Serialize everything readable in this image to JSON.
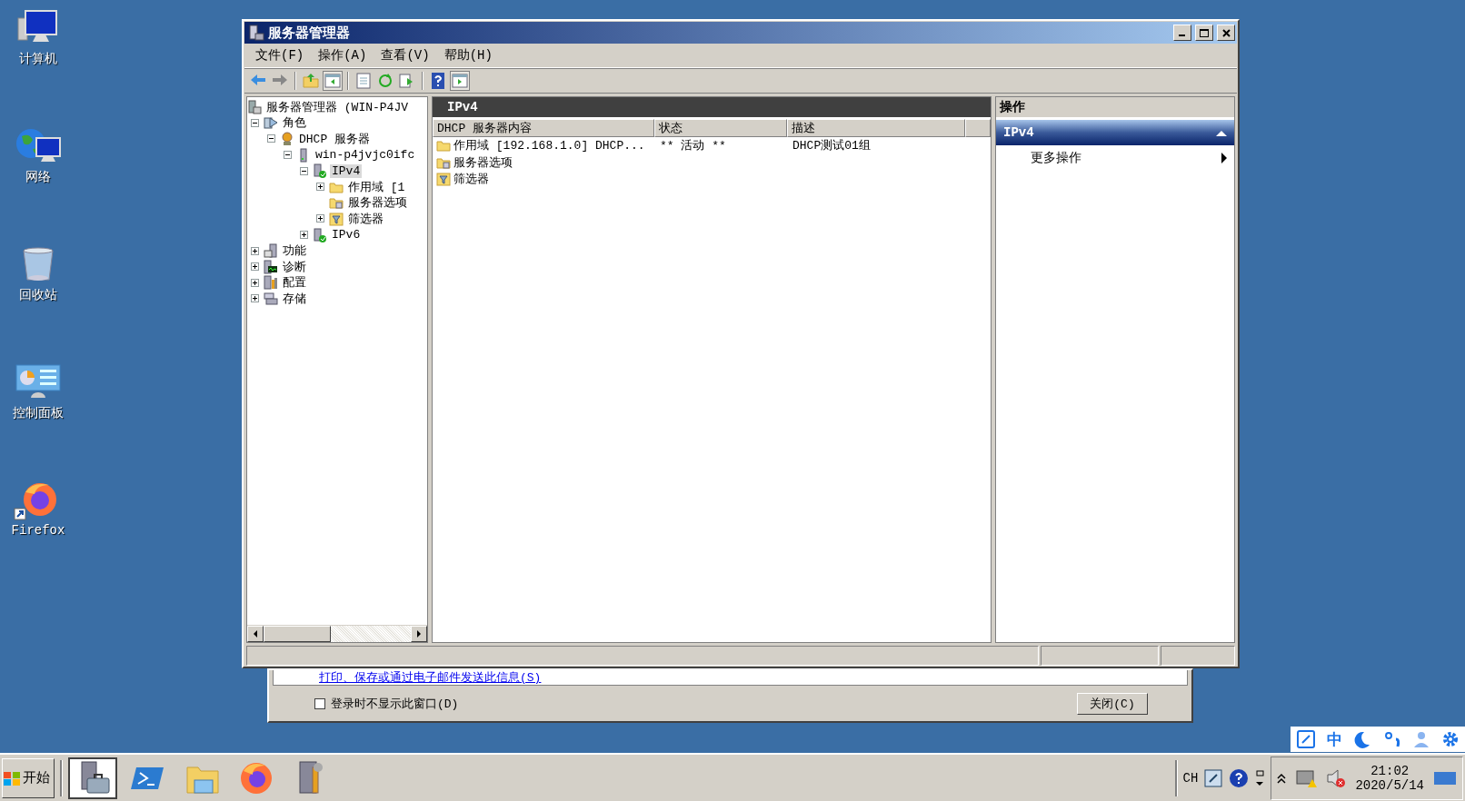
{
  "desktop_icons": [
    {
      "label": "计算机",
      "kind": "computer"
    },
    {
      "label": "网络",
      "kind": "network"
    },
    {
      "label": "回收站",
      "kind": "recycle"
    },
    {
      "label": "控制面板",
      "kind": "control"
    },
    {
      "label": "Firefox",
      "kind": "firefox"
    }
  ],
  "window": {
    "title": "服务器管理器",
    "menu": [
      "文件(F)",
      "操作(A)",
      "查看(V)",
      "帮助(H)"
    ],
    "tree": {
      "label": "服务器管理器 (WIN-P4JV",
      "kind": "manager",
      "selected": false,
      "children": [
        {
          "label": "角色",
          "kind": "roles",
          "expanded": true,
          "selected": false,
          "children": [
            {
              "label": "DHCP 服务器",
              "kind": "dhcp",
              "expanded": true,
              "selected": false,
              "children": [
                {
                  "label": "win-p4jvjc0ifc",
                  "kind": "server",
                  "expanded": true,
                  "selected": false,
                  "children": [
                    {
                      "label": "IPv4",
                      "kind": "protocol",
                      "expanded": true,
                      "selected": true,
                      "children": [
                        {
                          "label": "作用域 [1",
                          "kind": "folder",
                          "expanded": false,
                          "selected": false
                        },
                        {
                          "label": "服务器选项",
                          "kind": "options",
                          "selected": false
                        },
                        {
                          "label": "筛选器",
                          "kind": "filter",
                          "expanded": false,
                          "selected": false
                        }
                      ]
                    },
                    {
                      "label": "IPv6",
                      "kind": "protocol",
                      "expanded": false,
                      "selected": false
                    }
                  ]
                }
              ]
            }
          ]
        },
        {
          "label": "功能",
          "kind": "features",
          "expanded": false,
          "selected": false
        },
        {
          "label": "诊断",
          "kind": "diagnostics",
          "expanded": false,
          "selected": false
        },
        {
          "label": "配置",
          "kind": "config",
          "expanded": false,
          "selected": false
        },
        {
          "label": "存储",
          "kind": "storage",
          "expanded": false,
          "selected": false
        }
      ]
    },
    "details": {
      "header": "IPv4",
      "columns": [
        "DHCP 服务器内容",
        "状态",
        "描述"
      ],
      "rows": [
        {
          "name": "作用域 [192.168.1.0] DHCP...",
          "kind": "folder",
          "status": "** 活动 **",
          "description": "DHCP测试01组"
        },
        {
          "name": "服务器选项",
          "kind": "options"
        },
        {
          "name": "筛选器",
          "kind": "filter"
        }
      ]
    },
    "actions": {
      "title": "操作",
      "section": "IPv4",
      "expanded": true,
      "items": [
        {
          "label": "更多操作"
        }
      ]
    }
  },
  "dialog": {
    "link": "打印、保存或通过电子邮件发送此信息(S)",
    "checkbox": {
      "label": "登录时不显示此窗口(D)",
      "checked": false
    },
    "close_button": "关闭(C)"
  },
  "ime_bar": {
    "mode": "中"
  },
  "taskbar": {
    "start": "开始",
    "apps": [
      {
        "kind": "server-manager",
        "selected": true
      },
      {
        "kind": "powershell",
        "selected": false
      },
      {
        "kind": "explorer",
        "selected": false
      },
      {
        "kind": "firefox",
        "selected": false
      },
      {
        "kind": "server-tools",
        "selected": false
      }
    ],
    "language": "CH",
    "time": "21:02",
    "date": "2020/5/14"
  }
}
